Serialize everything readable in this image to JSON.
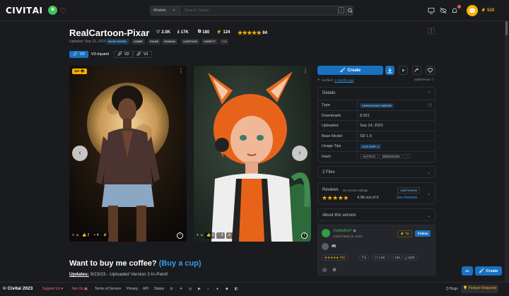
{
  "header": {
    "logo_a": "CIVIT",
    "logo_b": "AI",
    "search_category": "Models",
    "search_placeholder": "Search Civitai",
    "search_shortcut": "/",
    "buzz_amount": "510"
  },
  "model": {
    "title": "RealCartoon-Pixar",
    "likes": "2.0K",
    "downloads": "17K",
    "collections": "180",
    "tips": "124",
    "rating_count": "84",
    "updated": "Updated: Sep 23, 2023",
    "tags": [
      "BASE MODEL",
      "ANIME",
      "PIXAR",
      "WOMAN",
      "CARTOON",
      "VARIETY",
      "+ 3"
    ],
    "versions": [
      "V3",
      "V3-Inpaint",
      "V2",
      "V1"
    ]
  },
  "images": [
    {
      "badge": "13+",
      "plus": "+",
      "likes": "2",
      "hearts": "4",
      "stars": ""
    },
    {
      "plus": "+",
      "likes": "6",
      "hearts": "4",
      "stars": ""
    }
  ],
  "coffee": {
    "prefix": "Want to buy me coffee? ",
    "link": "(Buy a cup)"
  },
  "updates": {
    "label": "Updates:",
    "text": " 9/23/23 - Uploaded Version 3 In-Paint!"
  },
  "actions": {
    "create": "Create",
    "verified_prefix": "Verified: ",
    "verified_link": "2 months ago",
    "safetensor": "SafeTensor"
  },
  "details": {
    "title": "Details",
    "rows": [
      {
        "key": "Type",
        "value": "CHECKPOINT MERGE"
      },
      {
        "key": "Downloads",
        "value": "8,021"
      },
      {
        "key": "Uploaded",
        "value": "Sep 14, 2023"
      },
      {
        "key": "Base Model",
        "value": "SD 1.5"
      },
      {
        "key": "Usage Tips",
        "value": "CLIP SKIP: 2"
      },
      {
        "key": "Hash",
        "value": "AUTOV2",
        "value2": "EB00281DB"
      }
    ]
  },
  "files": {
    "title": "2 Files"
  },
  "reviews": {
    "title": "Reviews",
    "count": "45 version ratings",
    "score": "4.98 out of 5",
    "add": "Add Review",
    "see": "See Reviews"
  },
  "about": {
    "title": "About this version"
  },
  "creator": {
    "name": "7whitefire7",
    "joined": "Joined May 23, 2023",
    "tip": "Tip",
    "follow": "Follow",
    "rank": "#6",
    "stats": [
      "704",
      "5",
      "1.6K",
      "13K",
      "142K"
    ]
  },
  "footer": {
    "brand": "© Civitai 2023",
    "support": "Support Us",
    "join": "Join Us",
    "links": [
      "Terms of Service",
      "Privacy",
      "API",
      "Status"
    ],
    "bugs": "Bugs",
    "feature": "Feature Requests"
  },
  "fab": {
    "create": "Create"
  },
  "colors": {
    "accent": "#1971c2",
    "star": "#fab005",
    "bg": "#1a1b1e",
    "success": "#40c057"
  }
}
